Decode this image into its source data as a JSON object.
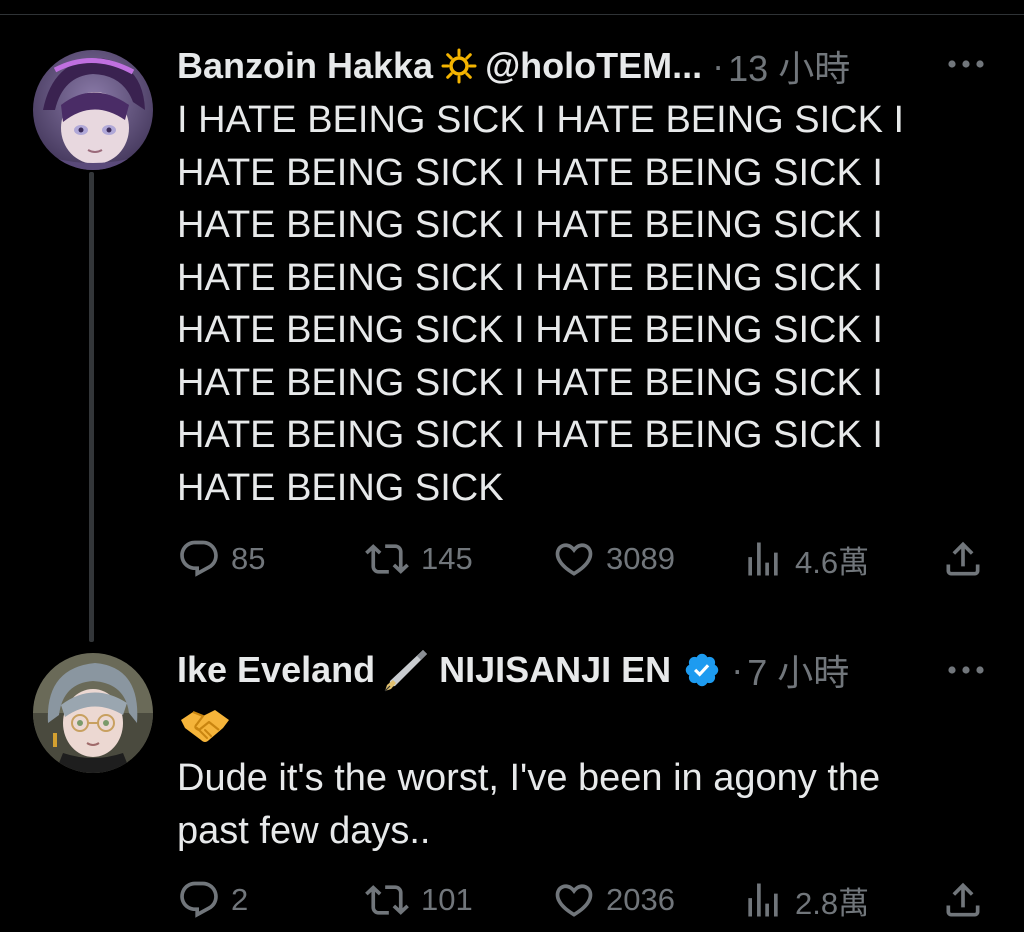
{
  "tweets": [
    {
      "author_name": "Banzoin Hakka",
      "name_emoji": "sun-emoji",
      "handle": "@holoTEM...",
      "separator": "·",
      "time": "13 小時",
      "text": "I HATE BEING SICK I HATE BEING SICK I\nHATE BEING SICK I HATE BEING SICK I\nHATE BEING SICK I HATE BEING SICK I\nHATE BEING SICK I HATE BEING SICK I\nHATE BEING SICK I HATE BEING SICK I\nHATE BEING SICK I HATE BEING SICK I\nHATE BEING SICK I HATE BEING SICK I\nHATE BEING SICK",
      "stats": {
        "replies": "85",
        "retweets": "145",
        "likes": "3089",
        "views": "4.6萬"
      }
    },
    {
      "author_name": "Ike Eveland",
      "name_emoji": "fountain-pen-emoji",
      "name_suffix": "NIJISANJI EN",
      "verified": true,
      "separator": "·",
      "time": "7 小時",
      "body_emoji": "handshake-emoji",
      "text": "Dude it's the worst, I've been in agony the\npast few days..",
      "stats": {
        "replies": "2",
        "retweets": "101",
        "likes": "2036",
        "views": "2.8萬"
      }
    }
  ],
  "colors": {
    "background": "#000000",
    "text": "#e7e9ea",
    "muted": "#71767b",
    "verified": "#1d9bf0",
    "thread_line": "#333639"
  }
}
